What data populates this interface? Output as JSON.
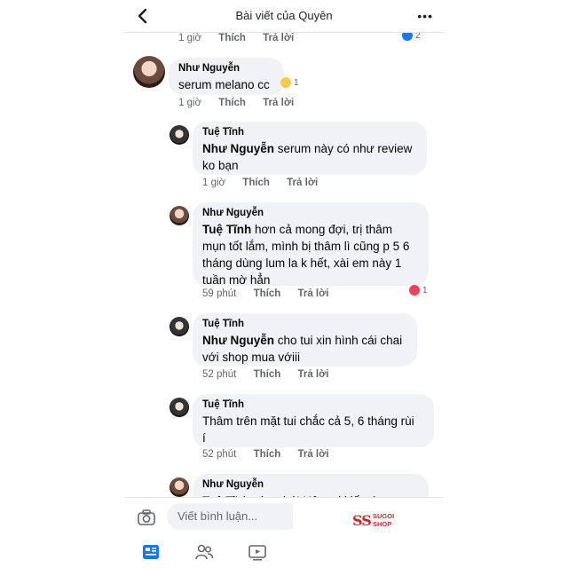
{
  "header": {
    "title": "Bài viết của Quyên"
  },
  "top_meta": {
    "time": "1 giờ",
    "like": "Thích",
    "reply": "Trả lời",
    "reaction_count": "2"
  },
  "comments": [
    {
      "name": "Như Nguyễn",
      "text": "serum melano cc",
      "time": "1 giờ",
      "like": "Thích",
      "reply": "Trả lời",
      "reaction_count": "1"
    },
    {
      "name": "Tuệ Tĩnh",
      "mention": "Như Nguyễn",
      "text_line1": " serum này có như review",
      "text_line2": "ko bạn",
      "time": "1 giờ",
      "like": "Thích",
      "reply": "Trả lời"
    },
    {
      "name": "Như Nguyễn",
      "mention": "Tuệ Tĩnh",
      "text_line1": "  hơn cả mong đợi, trị thâm",
      "text_line2": "mụn tốt lắm, mình bị thâm lì cũng p 5 6",
      "text_line3": "tháng dùng lum la k hết, xài em này 1",
      "text_line4": "tuần mờ hẳn",
      "time": "59 phút",
      "like": "Thích",
      "reply": "Trả lời",
      "reaction_count": "1"
    },
    {
      "name": "Tuệ Tĩnh",
      "mention": "Như Nguyễn",
      "text_line1": " cho tui xin hình cái chai",
      "text_line2": "với shop mua vớiii",
      "time": "52 phút",
      "like": "Thích",
      "reply": "Trả lời"
    },
    {
      "name": "Tuệ Tĩnh",
      "text_line1": "Thâm trên mặt tui chắc cả 5, 6 tháng rùi",
      "text_line2": "í",
      "time": "52 phút",
      "like": "Thích",
      "reply": "Trả lời"
    },
    {
      "name": "Như Nguyễn",
      "text_partial": "Tuệ Tĩnh  nàu nhé! Hận tui kiếm k ra"
    }
  ],
  "composer": {
    "placeholder": "Viết bình luận..."
  },
  "tabs": [
    "news-feed-icon",
    "friends-icon",
    "watch-icon"
  ],
  "watermark": {
    "mark": "SS",
    "line1": "SUGOI",
    "line2": "SHOP"
  }
}
